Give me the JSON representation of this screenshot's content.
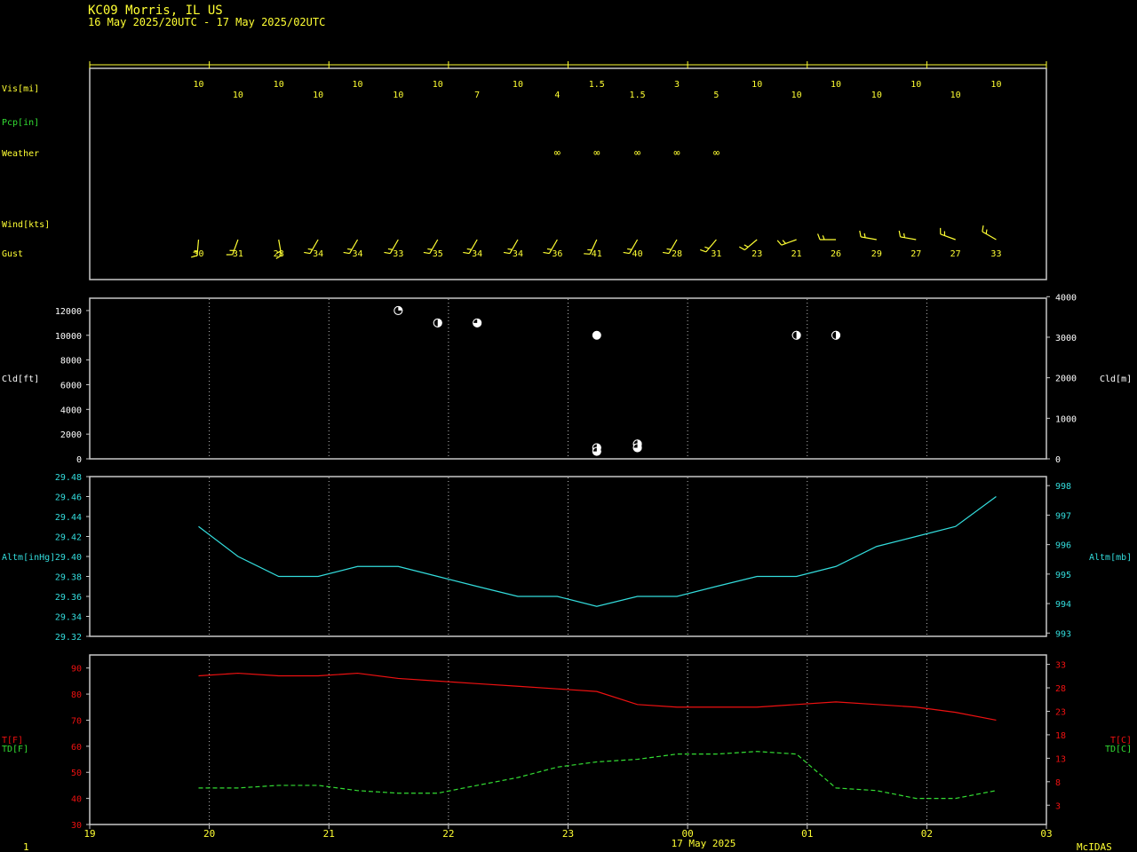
{
  "header": {
    "station": "KC09  Morris, IL US",
    "period": "16 May 2025/20UTC - 17 May 2025/02UTC"
  },
  "footer": {
    "date_label": "17 May 2025",
    "page_number": "1",
    "credit": "McIDAS"
  },
  "colors": {
    "yellow": "#ffff33",
    "green": "#33dd33",
    "cyan": "#33dddd",
    "red": "#ee1111",
    "white": "#ffffff",
    "frame": "#c8c8c8"
  },
  "chart_data": [
    {
      "type": "table",
      "panel": "surface-observations",
      "x_hours": [
        19.91,
        20.24,
        20.58,
        20.91,
        21.24,
        21.58,
        21.91,
        22.24,
        22.58,
        22.91,
        23.24,
        23.58,
        23.91,
        24.24,
        24.58,
        24.91,
        25.24,
        25.58,
        25.91,
        26.24,
        26.58
      ],
      "row_labels": {
        "vis": "Vis[mi]",
        "pcp": "Pcp[in]",
        "weather": "Weather",
        "wind": "Wind[kts]",
        "gust": "Gust"
      },
      "vis": [
        "10",
        "10",
        "10",
        "10",
        "10",
        "10",
        "10",
        "7",
        "10",
        "4",
        "1.5",
        "1.5",
        "3",
        "5",
        "10",
        "10",
        "10",
        "10",
        "10",
        "10",
        "10"
      ],
      "weather_symbol": "∞",
      "weather": [
        "",
        "",
        "",
        "",
        "",
        "",
        "",
        "",
        "",
        "∞",
        "∞",
        "∞",
        "∞",
        "∞",
        "",
        "",
        "",
        "",
        "",
        "",
        ""
      ],
      "wind_dir_deg": [
        185,
        200,
        170,
        210,
        210,
        210,
        210,
        210,
        210,
        210,
        205,
        210,
        210,
        220,
        230,
        250,
        270,
        280,
        280,
        290,
        300
      ],
      "gust": [
        "30",
        "31",
        "28",
        "34",
        "34",
        "33",
        "35",
        "34",
        "34",
        "36",
        "41",
        "40",
        "28",
        "31",
        "23",
        "21",
        "26",
        "29",
        "27",
        "27",
        "33"
      ],
      "xlim": [
        19,
        27
      ]
    },
    {
      "type": "scatter",
      "panel": "cloud-base",
      "ylabel": "Cld[ft]",
      "ylabel_right": "Cld[m]",
      "ylim": [
        0,
        13000
      ],
      "yticks": [
        0,
        2000,
        4000,
        6000,
        8000,
        10000,
        12000
      ],
      "yticks_right": [
        "0",
        "1000",
        "2000",
        "3000",
        "4000"
      ],
      "yticks_right_values_m": [
        0,
        1000,
        2000,
        3000,
        4000
      ],
      "points": [
        {
          "x": 21.58,
          "ft": 12000,
          "cover": "scattered"
        },
        {
          "x": 21.91,
          "ft": 11000,
          "cover": "broken-half"
        },
        {
          "x": 22.24,
          "ft": 11000,
          "cover": "broken"
        },
        {
          "x": 23.24,
          "ft": 10000,
          "cover": "overcast"
        },
        {
          "x": 23.24,
          "ft": 900,
          "cover": "broken"
        },
        {
          "x": 23.24,
          "ft": 600,
          "cover": "broken"
        },
        {
          "x": 23.58,
          "ft": 1200,
          "cover": "broken"
        },
        {
          "x": 23.58,
          "ft": 900,
          "cover": "broken"
        },
        {
          "x": 24.91,
          "ft": 10000,
          "cover": "broken-half"
        },
        {
          "x": 25.24,
          "ft": 10000,
          "cover": "broken-half"
        }
      ],
      "grid": true,
      "xlim": [
        19,
        27
      ]
    },
    {
      "type": "line",
      "panel": "altimeter",
      "ylabel": "Altm[inHg]",
      "ylabel_right": "Altm[mb]",
      "ylim": [
        29.32,
        29.48
      ],
      "yticks": [
        "29.32",
        "29.34",
        "29.36",
        "29.38",
        "29.40",
        "29.42",
        "29.44",
        "29.46",
        "29.48"
      ],
      "yticks_values": [
        29.32,
        29.34,
        29.36,
        29.38,
        29.4,
        29.42,
        29.44,
        29.46,
        29.48
      ],
      "yticks_right": [
        "993",
        "994",
        "995",
        "996",
        "997",
        "998"
      ],
      "yticks_right_values_mb": [
        993,
        994,
        995,
        996,
        997,
        998
      ],
      "x": [
        19.91,
        20.24,
        20.58,
        20.91,
        21.24,
        21.58,
        21.91,
        22.24,
        22.58,
        22.91,
        23.24,
        23.58,
        23.91,
        24.24,
        24.58,
        24.91,
        25.24,
        25.58,
        25.91,
        26.24,
        26.58
      ],
      "values": [
        29.43,
        29.4,
        29.38,
        29.38,
        29.39,
        29.39,
        29.38,
        29.37,
        29.36,
        29.36,
        29.35,
        29.36,
        29.36,
        29.37,
        29.38,
        29.38,
        29.39,
        29.41,
        29.42,
        29.43,
        29.46
      ],
      "grid": true,
      "xlim": [
        19,
        27
      ]
    },
    {
      "type": "line",
      "panel": "temperature",
      "ylabel_t": "T[F]",
      "ylabel_td": "TD[F]",
      "ylabel_t_right": "T[C]",
      "ylabel_td_right": "TD[C]",
      "ylim": [
        30,
        95
      ],
      "yticks": [
        "30",
        "40",
        "50",
        "60",
        "70",
        "80",
        "90"
      ],
      "yticks_values": [
        30,
        40,
        50,
        60,
        70,
        80,
        90
      ],
      "yticks_right": [
        "3",
        "8",
        "13",
        "18",
        "23",
        "28",
        "33"
      ],
      "yticks_right_values_c": [
        3,
        8,
        13,
        18,
        23,
        28,
        33
      ],
      "x": [
        19.91,
        20.24,
        20.58,
        20.91,
        21.24,
        21.58,
        21.91,
        22.24,
        22.58,
        22.91,
        23.24,
        23.58,
        23.91,
        24.24,
        24.58,
        24.91,
        25.24,
        25.58,
        25.91,
        26.24,
        26.58
      ],
      "series": [
        {
          "values": [
            87,
            88,
            87,
            87,
            88,
            86,
            85,
            84,
            83,
            82,
            81,
            76,
            75,
            75,
            75,
            76,
            77,
            76,
            75,
            73,
            70
          ],
          "style": "solid"
        },
        {
          "values": [
            44,
            44,
            45,
            45,
            43,
            42,
            42,
            45,
            48,
            52,
            54,
            55,
            57,
            57,
            58,
            57,
            44,
            43,
            40,
            40,
            43
          ],
          "style": "dashed"
        }
      ],
      "xlabel_ticks": [
        "19",
        "20",
        "21",
        "22",
        "23",
        "00",
        "01",
        "02",
        "03"
      ],
      "grid": true,
      "xlim": [
        19,
        27
      ]
    }
  ]
}
